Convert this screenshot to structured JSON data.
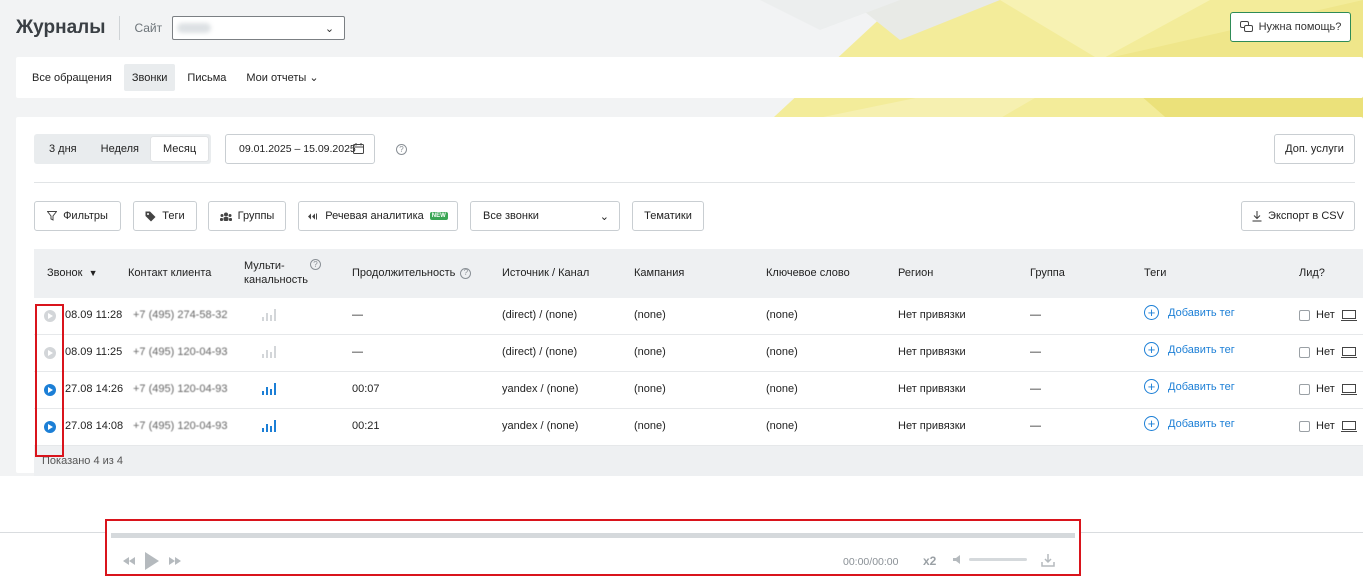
{
  "header": {
    "title": "Журналы",
    "site_label": "Сайт",
    "help_label": "Нужна помощь?"
  },
  "tabs": [
    {
      "label": "Все обращения"
    },
    {
      "label": "Звонки"
    },
    {
      "label": "Письма"
    },
    {
      "label": "Мои отчеты"
    }
  ],
  "period": {
    "options": [
      "3 дня",
      "Неделя",
      "Месяц"
    ],
    "selected": "Месяц",
    "date_range": "09.01.2025 – 15.09.2025"
  },
  "toolbar": {
    "extra_services": "Доп. услуги",
    "filters": "Фильтры",
    "tags": "Теги",
    "groups": "Группы",
    "speech": "Речевая аналитика",
    "new_badge": "NEW",
    "calls_select": "Все звонки",
    "topics": "Тематики",
    "export": "Экспорт в CSV"
  },
  "table": {
    "columns": {
      "call": "Звонок",
      "contact": "Контакт клиента",
      "multi_1": "Мульти-",
      "multi_2": "канальность",
      "duration": "Продолжительность",
      "source": "Источник / Канал",
      "campaign": "Кампания",
      "keyword": "Ключевое слово",
      "region": "Регион",
      "group": "Группа",
      "tags": "Теги",
      "lead": "Лид?"
    },
    "rows": [
      {
        "datetime": "08.09 11:28",
        "phone": "+7 (495) 274-58-32",
        "duration": "—",
        "source": "(direct) / (none)",
        "campaign": "(none)",
        "keyword": "(none)",
        "region": "Нет привязки",
        "group": "—",
        "tag": "Добавить тег",
        "lead": "Нет"
      },
      {
        "datetime": "08.09 11:25",
        "phone": "+7 (495) 120-04-93",
        "duration": "—",
        "source": "(direct) / (none)",
        "campaign": "(none)",
        "keyword": "(none)",
        "region": "Нет привязки",
        "group": "—",
        "tag": "Добавить тег",
        "lead": "Нет"
      },
      {
        "datetime": "27.08 14:26",
        "phone": "+7 (495) 120-04-93",
        "duration": "00:07",
        "source": "yandex / (none)",
        "campaign": "(none)",
        "keyword": "(none)",
        "region": "Нет привязки",
        "group": "—",
        "tag": "Добавить тег",
        "lead": "Нет"
      },
      {
        "datetime": "27.08 14:08",
        "phone": "+7 (495) 120-04-93",
        "duration": "00:21",
        "source": "yandex / (none)",
        "campaign": "(none)",
        "keyword": "(none)",
        "region": "Нет привязки",
        "group": "—",
        "tag": "Добавить тег",
        "lead": "Нет"
      }
    ],
    "footer": "Показано 4 из 4"
  },
  "player": {
    "time": "00:00/00:00",
    "speed": "x2"
  },
  "colors": {
    "accent_blue": "#1c7fd6",
    "highlight_red": "#d9141c",
    "help_border": "#2e8b57",
    "bg_yellow": "#f3ec9a"
  }
}
